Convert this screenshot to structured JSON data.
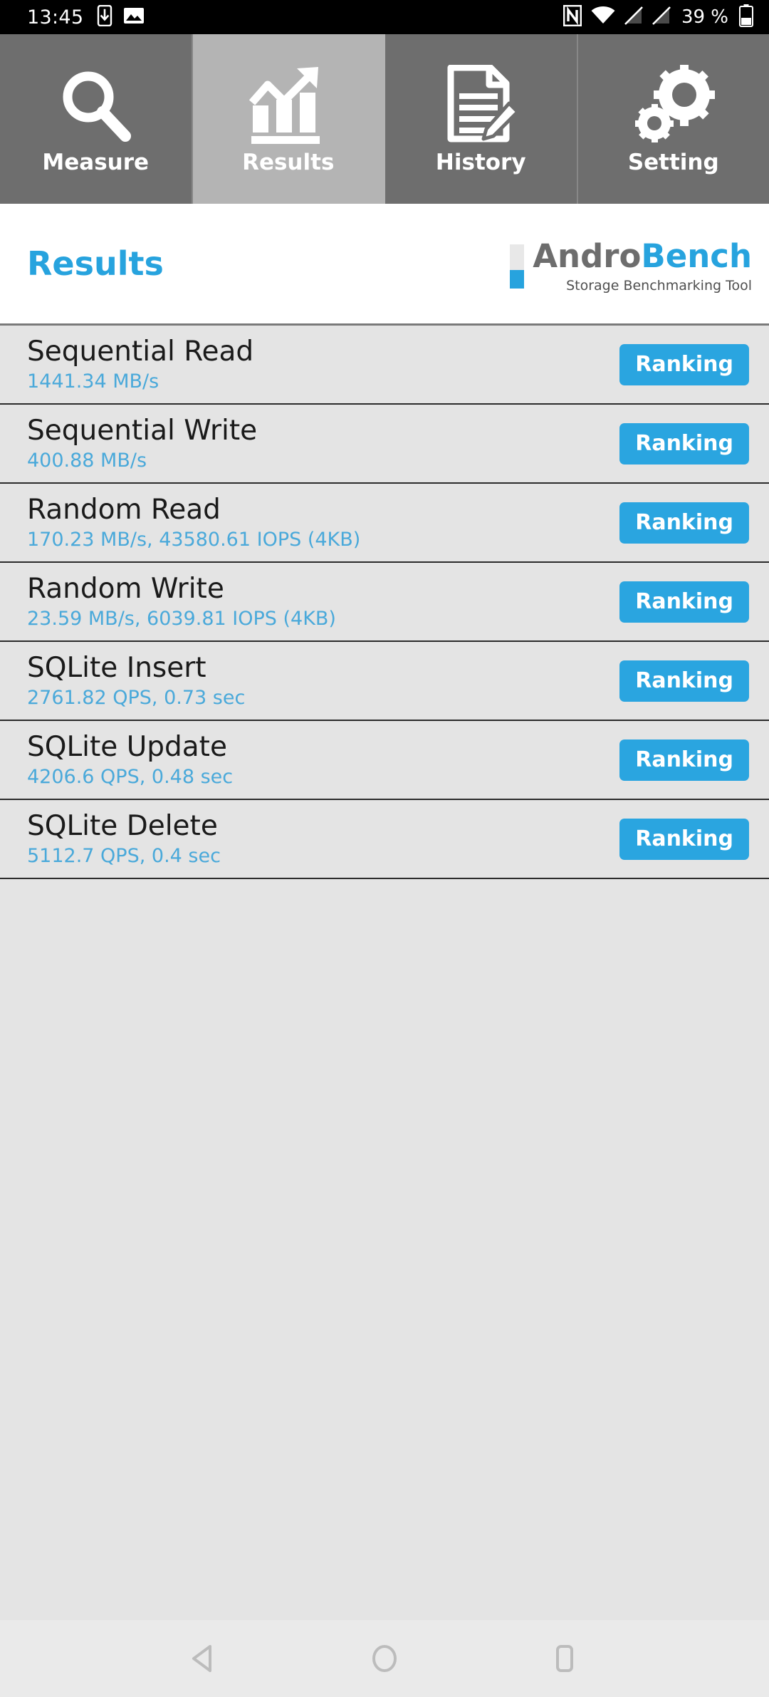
{
  "statusbar": {
    "time": "13:45",
    "battery_percent": "39 %",
    "icons": {
      "left": [
        "phone-download-icon",
        "image-icon"
      ],
      "right": [
        "nfc-icon",
        "wifi-icon",
        "signal-off-icon",
        "signal-off-icon",
        "battery-icon"
      ]
    }
  },
  "tabs": [
    {
      "label": "Measure",
      "icon": "magnifier-icon",
      "selected": false
    },
    {
      "label": "Results",
      "icon": "bar-chart-arrow-icon",
      "selected": true
    },
    {
      "label": "History",
      "icon": "document-pencil-icon",
      "selected": false
    },
    {
      "label": "Setting",
      "icon": "gears-icon",
      "selected": false
    }
  ],
  "header": {
    "title": "Results",
    "logo_andro": "Andro",
    "logo_bench": "Bench",
    "logo_subtitle": "Storage Benchmarking Tool"
  },
  "results": [
    {
      "name": "Sequential Read",
      "value": "1441.34 MB/s",
      "button": "Ranking"
    },
    {
      "name": "Sequential Write",
      "value": "400.88 MB/s",
      "button": "Ranking"
    },
    {
      "name": "Random Read",
      "value": "170.23 MB/s, 43580.61 IOPS (4KB)",
      "button": "Ranking"
    },
    {
      "name": "Random Write",
      "value": "23.59 MB/s, 6039.81 IOPS (4KB)",
      "button": "Ranking"
    },
    {
      "name": "SQLite Insert",
      "value": "2761.82 QPS, 0.73 sec",
      "button": "Ranking"
    },
    {
      "name": "SQLite Update",
      "value": "4206.6 QPS, 0.48 sec",
      "button": "Ranking"
    },
    {
      "name": "SQLite Delete",
      "value": "5112.7 QPS, 0.4 sec",
      "button": "Ranking"
    }
  ],
  "navbar": {
    "back": "back-triangle-icon",
    "home": "home-circle-icon",
    "recents": "recents-square-icon"
  },
  "colors": {
    "accent_blue": "#27a3de",
    "value_blue": "#4aa9da",
    "button_blue": "#2aa5e0",
    "tab_unselected": "#6e6e6e",
    "tab_selected": "#b4b4b4",
    "list_bg": "#e4e4e4",
    "statusbar_bg": "#000000"
  }
}
